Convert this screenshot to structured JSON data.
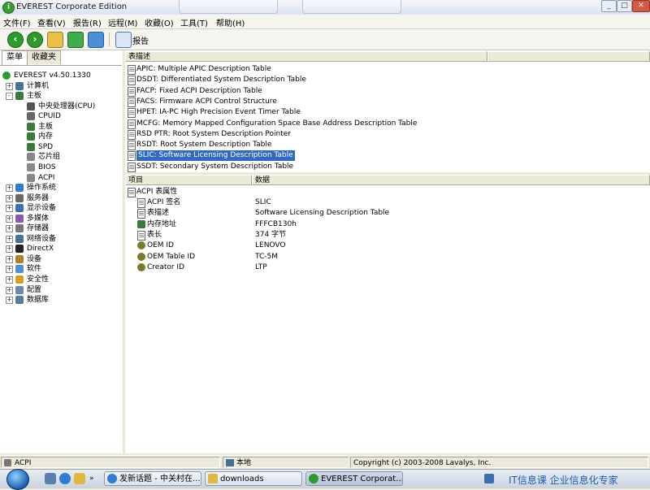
{
  "titlebar": {
    "title": "EVEREST Corporate Edition"
  },
  "menu": {
    "items": [
      "文件(F)",
      "查看(V)",
      "报告(R)",
      "远程(M)",
      "收藏(O)",
      "工具(T)",
      "帮助(H)"
    ]
  },
  "toolbar": {
    "report_label": "报告",
    "icons": [
      "back-icon",
      "forward-icon",
      "up-folder-icon",
      "refresh-icon",
      "users-icon",
      "report-icon"
    ]
  },
  "left": {
    "tabs": [
      "菜单",
      "收藏夹"
    ],
    "tree": [
      {
        "label": "EVEREST v4.50.1330",
        "icon": "everest-icon",
        "depth": 0
      },
      {
        "label": "计算机",
        "icon": "computer-icon",
        "depth": 1,
        "expander": "+"
      },
      {
        "label": "主板",
        "icon": "motherboard-icon",
        "depth": 1,
        "expander": "-"
      },
      {
        "label": "中央处理器(CPU)",
        "icon": "cpu-icon",
        "depth": 2
      },
      {
        "label": "CPUID",
        "icon": "cpuid-icon",
        "depth": 2
      },
      {
        "label": "主板",
        "icon": "motherboard-icon",
        "depth": 2
      },
      {
        "label": "内存",
        "icon": "memory-icon",
        "depth": 2
      },
      {
        "label": "SPD",
        "icon": "spd-icon",
        "depth": 2
      },
      {
        "label": "芯片组",
        "icon": "chipset-icon",
        "depth": 2
      },
      {
        "label": "BIOS",
        "icon": "bios-icon",
        "depth": 2
      },
      {
        "label": "ACPI",
        "icon": "acpi-icon",
        "depth": 2
      },
      {
        "label": "操作系统",
        "icon": "os-icon",
        "depth": 1,
        "expander": "+"
      },
      {
        "label": "服务器",
        "icon": "server-icon",
        "depth": 1,
        "expander": "+"
      },
      {
        "label": "显示设备",
        "icon": "display-icon",
        "depth": 1,
        "expander": "+"
      },
      {
        "label": "多媒体",
        "icon": "multimedia-icon",
        "depth": 1,
        "expander": "+"
      },
      {
        "label": "存储器",
        "icon": "storage-icon",
        "depth": 1,
        "expander": "+"
      },
      {
        "label": "网络设备",
        "icon": "network-icon",
        "depth": 1,
        "expander": "+"
      },
      {
        "label": "DirectX",
        "icon": "directx-icon",
        "depth": 1,
        "expander": "+"
      },
      {
        "label": "设备",
        "icon": "devices-icon",
        "depth": 1,
        "expander": "+"
      },
      {
        "label": "软件",
        "icon": "software-icon",
        "depth": 1,
        "expander": "+"
      },
      {
        "label": "安全性",
        "icon": "security-icon",
        "depth": 1,
        "expander": "+"
      },
      {
        "label": "配置",
        "icon": "config-icon",
        "depth": 1,
        "expander": "+"
      },
      {
        "label": "数据库",
        "icon": "database-icon",
        "depth": 1,
        "expander": "+"
      }
    ]
  },
  "table_list": {
    "header": "表描述",
    "rows": [
      "APIC: Multiple APIC Description Table",
      "DSDT: Differentiated System Description Table",
      "FACP: Fixed ACPI Description Table",
      "FACS: Firmware ACPI Control Structure",
      "HPET: IA-PC High Precision Event Timer Table",
      "MCFG: Memory Mapped Configuration Space Base Address Description Table",
      "RSD PTR: Root System Description Pointer",
      "RSDT: Root System Description Table",
      "SLIC: Software Licensing Description Table",
      "SSDT: Secondary System Description Table"
    ],
    "selected_index": 8
  },
  "details": {
    "col_item": "项目",
    "col_data": "数据",
    "group": "ACPI 表属性",
    "rows": [
      {
        "item": "ACPI 签名",
        "value": "SLIC",
        "icon": "doc-icon"
      },
      {
        "item": "表描述",
        "value": "Software Licensing Description Table",
        "icon": "doc-icon"
      },
      {
        "item": "内存地址",
        "value": "FFFCB130h",
        "icon": "memory-icon"
      },
      {
        "item": "表长",
        "value": "374 字节",
        "icon": "doc-icon"
      },
      {
        "item": "OEM ID",
        "value": "LENOVO",
        "icon": "gear-icon"
      },
      {
        "item": "OEM Table ID",
        "value": "TC-5M",
        "icon": "gear-icon"
      },
      {
        "item": "Creator ID",
        "value": "LTP",
        "icon": "gear-icon"
      }
    ]
  },
  "status": {
    "left": "ACPI",
    "middle": "本地",
    "right": "Copyright (c) 2003-2008 Lavalys, Inc."
  },
  "taskbar": {
    "buttons": [
      "发新话题 - 中关村在...",
      "downloads",
      "EVEREST Corporat..."
    ],
    "active_index": 2,
    "watermark": "IT信息课 企业信息化专家"
  },
  "colors": {
    "selection": "#316ac5",
    "accent_green": "#2e9a2e"
  }
}
